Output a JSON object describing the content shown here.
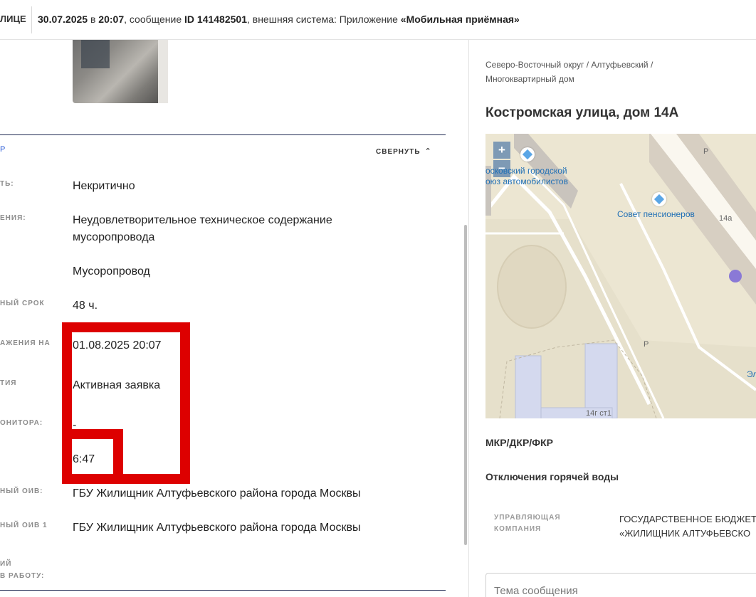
{
  "header": {
    "crumb_tail": "ЛИЦЕ",
    "datetime": "30.07.2025",
    "time_prefix": "в",
    "time": "20:07",
    "msg_prefix": ", сообщение",
    "msg_id": "ID 141482501",
    "system_prefix": ", внешняя система: Приложение",
    "system_name": "«Мобильная приёмная»"
  },
  "details": {
    "section_mark": "Р",
    "collapse_label": "СВЕРНУТЬ",
    "rows": [
      {
        "label": "ТЬ:",
        "value": "Некритично"
      },
      {
        "label": "ЕНИЯ:",
        "value": "Неудовлетворительное техническое содержание мусоропровода"
      },
      {
        "label": "",
        "value": "Мусоропровод"
      },
      {
        "label": "НЫЙ СРОК",
        "value": "48 ч."
      },
      {
        "label": "АЖЕНИЯ НА",
        "value": "01.08.2025 20:07"
      },
      {
        "label": "ТИЯ",
        "value": "Активная заявка"
      },
      {
        "label": "ОНИТОРА:",
        "value": "-"
      },
      {
        "label": "",
        "value": "6:47"
      },
      {
        "label": "НЫЙ ОИВ:",
        "value": "ГБУ Жилищник Алтуфьевского района города Москвы"
      },
      {
        "label": "НЫЙ ОИВ 1",
        "value": "ГБУ Жилищник Алтуфьевского района города Москвы"
      },
      {
        "label": "ИЙ",
        "value": ""
      },
      {
        "label": "В РАБОТУ:",
        "value": ""
      }
    ]
  },
  "address": {
    "breadcrumb": "Северо-Восточный округ / Алтуфьевский / Многоквартирный дом",
    "title": "Костромская улица, дом 14А"
  },
  "map": {
    "zoom_in": "+",
    "zoom_out": "−",
    "labels": {
      "org1_line1": "осковский городской",
      "org1_line2": "оюз автомобилистов",
      "org2": "Совет пенсионеров",
      "building1": "14а",
      "building2": "14г ст1",
      "parking": "Р",
      "edge": "Эл"
    }
  },
  "info": {
    "mkr": "МКР/ДКР/ФКР",
    "hot_water": "Отключения горячей воды",
    "company_key": "УПРАВЛЯЮЩАЯ КОМПАНИЯ",
    "company_value_1": "ГОСУДАРСТВЕННОЕ БЮДЖЕТ",
    "company_value_2": "«ЖИЛИЩНИК АЛТУФЬЕВСКО"
  },
  "message": {
    "placeholder": "Тема сообщения"
  },
  "colors": {
    "accent_line": "#1f2a52",
    "annotation_red": "#dd0000",
    "map_bg": "#ece6d2",
    "marker": "#8a79d6"
  }
}
